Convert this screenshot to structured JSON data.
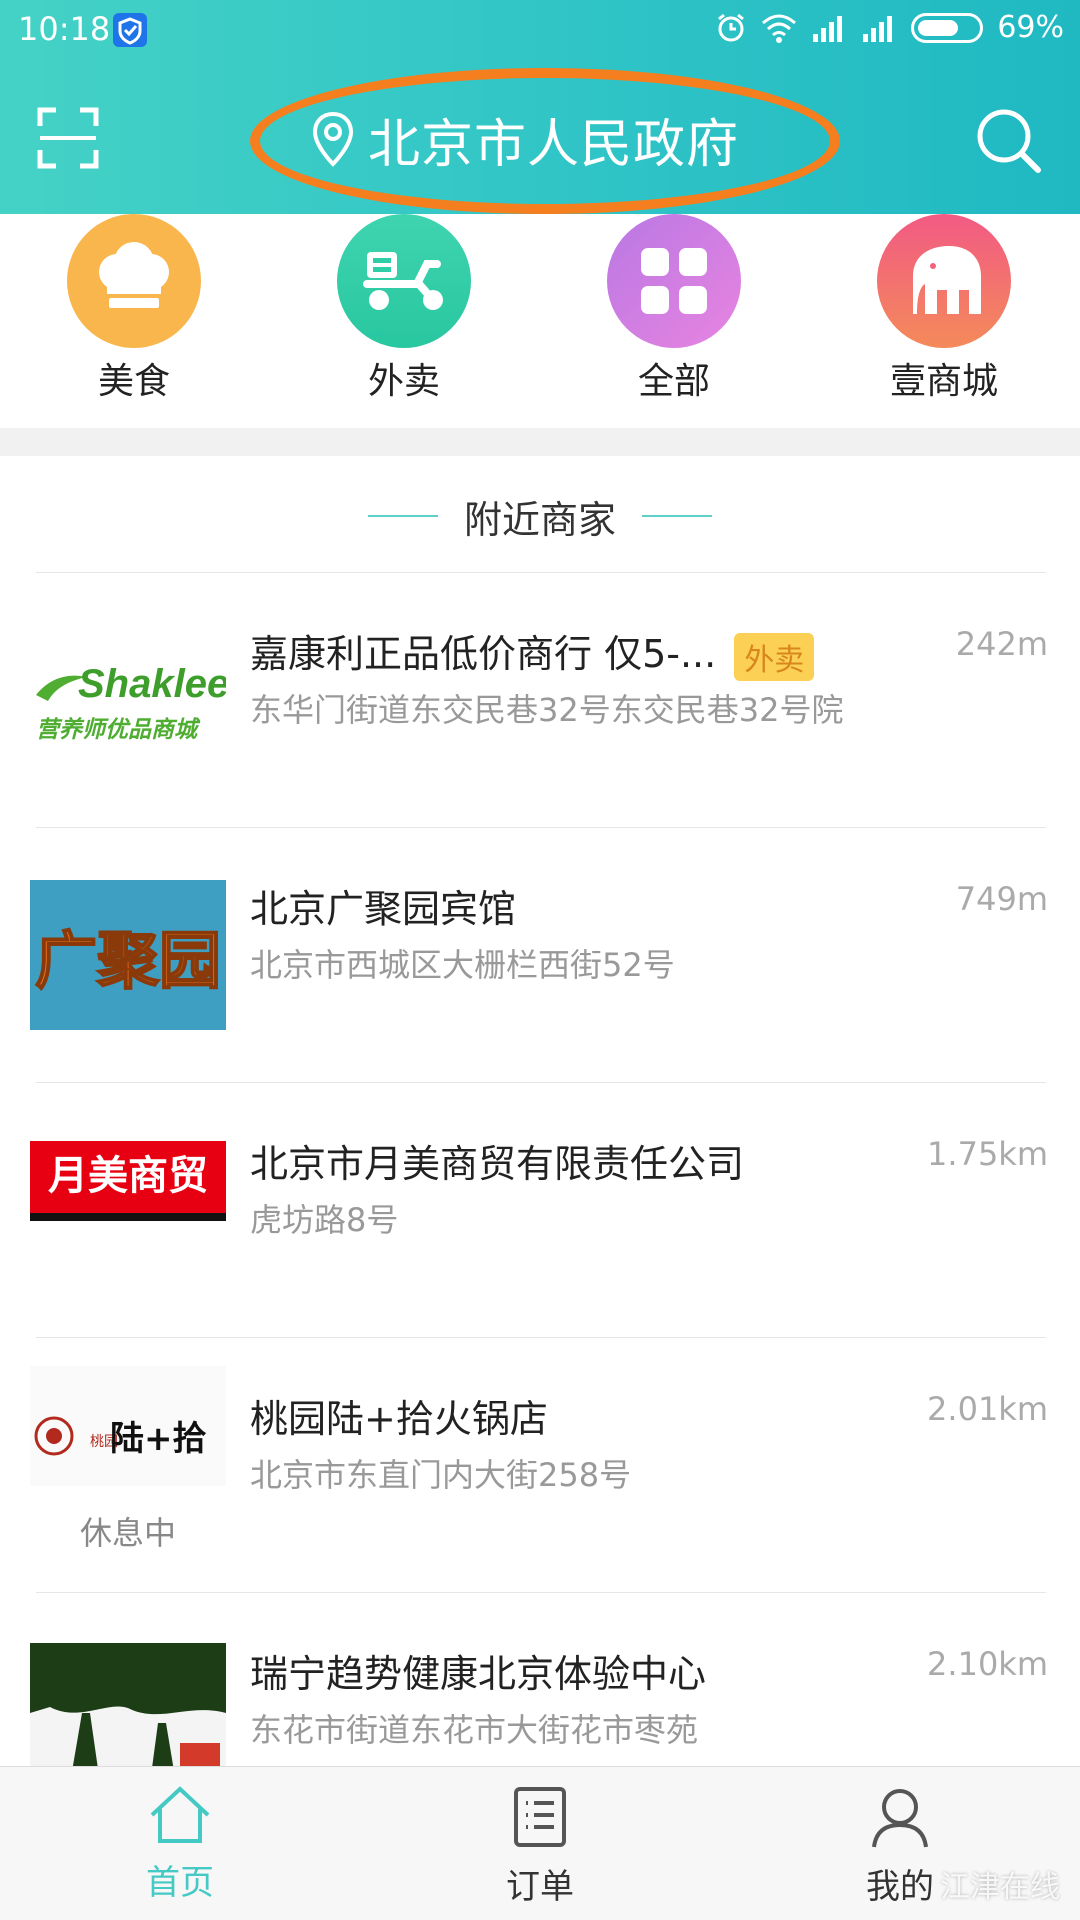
{
  "status_bar": {
    "time": "10:18",
    "battery": "69%",
    "battery_level": 0.69
  },
  "header": {
    "location": "北京市人民政府"
  },
  "categories": [
    {
      "label": "美食",
      "icon": "chef-hat-icon",
      "color": "#f8b64c"
    },
    {
      "label": "外卖",
      "icon": "scooter-icon",
      "color": "#2ecfa7"
    },
    {
      "label": "全部",
      "icon": "grid-icon",
      "color": "#c77fe6"
    },
    {
      "label": "壹商城",
      "icon": "elephant-icon",
      "color": "#f2607a"
    }
  ],
  "section_title": "附近商家",
  "merchants": [
    {
      "name": "嘉康利正品低价商行 仅5-...",
      "badge": "外卖",
      "address": "东华门街道东交民巷32号东交民巷32号院",
      "distance": "242m",
      "logo_line1": "Shaklee",
      "logo_line2": "营养师优品商城"
    },
    {
      "name": "北京广聚园宾馆",
      "address": "北京市西城区大栅栏西街52号",
      "distance": "749m",
      "logo_text": "广聚园"
    },
    {
      "name": "北京市月美商贸有限责任公司",
      "address": "虎坊路8号",
      "distance": "1.75km",
      "logo_text": "月美商贸"
    },
    {
      "name": "桃园陆+拾火锅店",
      "address": "北京市东直门内大街258号",
      "distance": "2.01km",
      "logo_text": "陆+拾",
      "logo_small": "桃园",
      "status": "休息中"
    },
    {
      "name": "瑞宁趋势健康北京体验中心",
      "address": "东花市街道东花市大街花市枣苑",
      "distance": "2.10km"
    }
  ],
  "bottom_nav": [
    {
      "label": "首页",
      "icon": "home-icon",
      "active": true
    },
    {
      "label": "订单",
      "icon": "order-list-icon",
      "active": false
    },
    {
      "label": "我的",
      "icon": "profile-icon",
      "active": false
    }
  ],
  "watermark": "江津在线"
}
